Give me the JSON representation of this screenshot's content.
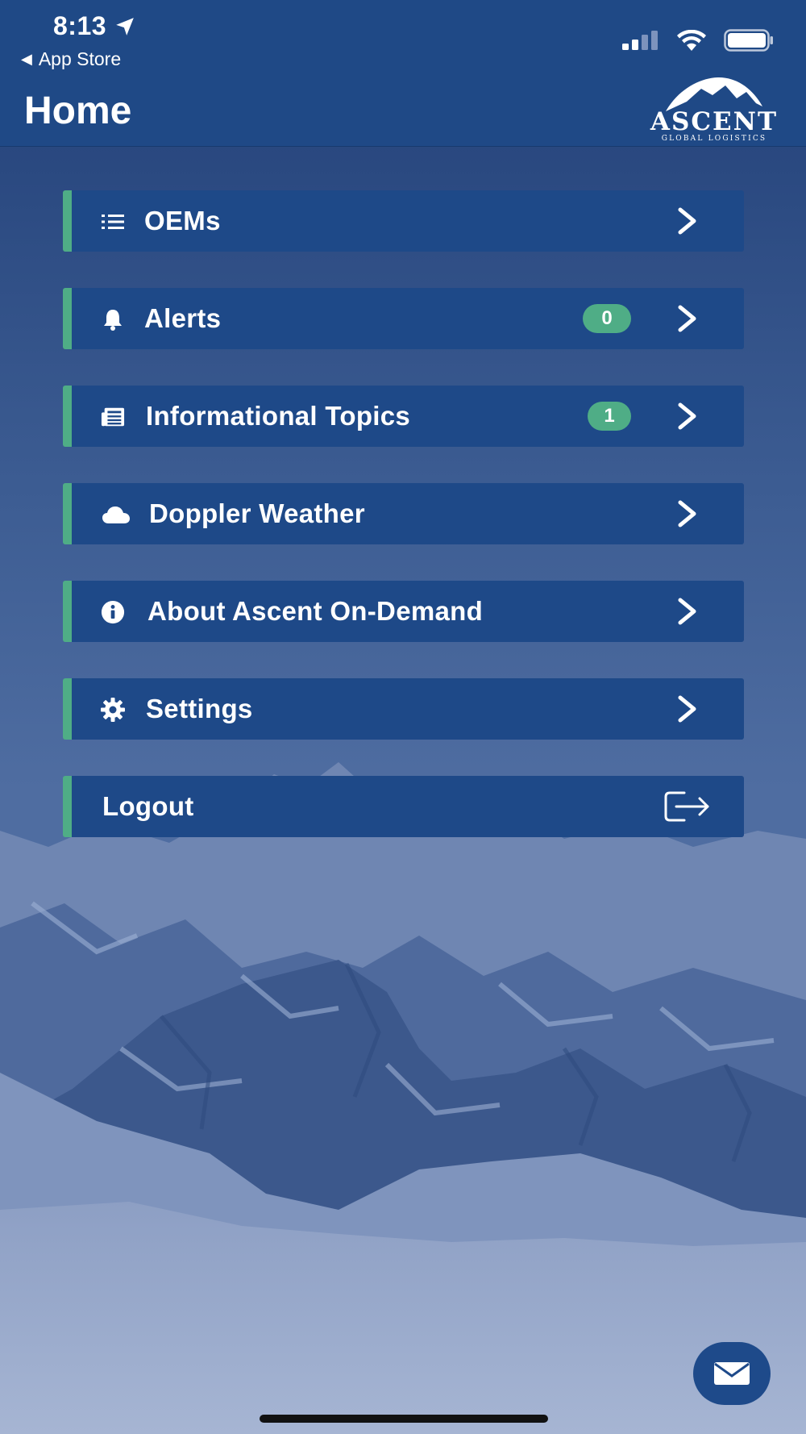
{
  "status_bar": {
    "time": "8:13",
    "back_app": "App Store",
    "icons": [
      "location-arrow-icon",
      "cellular-signal-icon",
      "wifi-icon",
      "battery-icon"
    ]
  },
  "header": {
    "title": "Home",
    "logo": {
      "wordmark": "ASCENT",
      "tagline": "GLOBAL LOGISTICS"
    }
  },
  "menu": {
    "items": [
      {
        "label": "OEMs",
        "icon": "list-icon",
        "badge": null
      },
      {
        "label": "Alerts",
        "icon": "bell-icon",
        "badge": "0"
      },
      {
        "label": "Informational Topics",
        "icon": "newspaper-icon",
        "badge": "1"
      },
      {
        "label": "Doppler Weather",
        "icon": "cloud-icon",
        "badge": null
      },
      {
        "label": "About Ascent On-Demand",
        "icon": "info-icon",
        "badge": null
      },
      {
        "label": "Settings",
        "icon": "gear-icon",
        "badge": null
      }
    ],
    "logout_label": "Logout"
  },
  "fab": {
    "icon": "mail-icon"
  },
  "colors": {
    "header_bg": "#1f4986",
    "item_bg": "#1e4988",
    "accent_green": "#4fad86",
    "overlay_blue": "#23477f"
  }
}
